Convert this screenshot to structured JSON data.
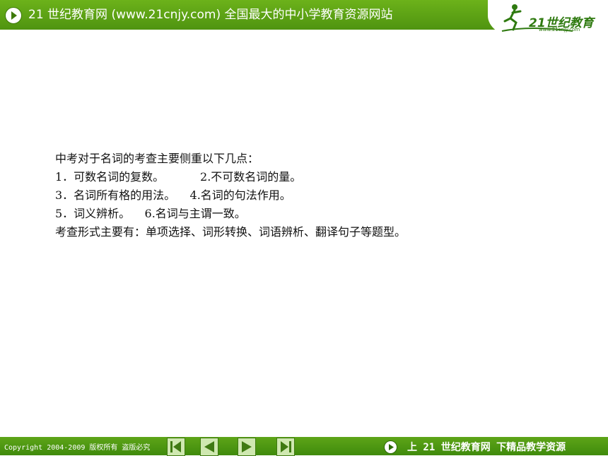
{
  "header": {
    "title": "21 世纪教育网 (www.21cnjy.com)  全国最大的中小学教育资源网站",
    "logo_text": "21世纪教育",
    "logo_url": "www.21cnjy.com"
  },
  "content": {
    "lines": [
      "中考对于名词的考查主要侧重以下几点：",
      "1．可数名词的复数。          2.不可数名词的量。",
      "3．名词所有格的用法。    4.名词的句法作用。",
      "5．词义辨析。    6.名词与主谓一致。",
      "考查形式主要有：单项选择、词形转换、词语辨析、翻译句子等题型。"
    ]
  },
  "footer": {
    "copyright": "Copyright 2004-2009 版权所有 盗版必究",
    "slogan": "上 21 世纪教育网  下精品教学资源",
    "nav": [
      "first-slide",
      "previous-slide",
      "next-slide",
      "last-slide"
    ]
  },
  "colors": {
    "bar_green": "#5ea518",
    "accent_dark": "#2f7a10",
    "button_fill": "#cfe8b0"
  }
}
